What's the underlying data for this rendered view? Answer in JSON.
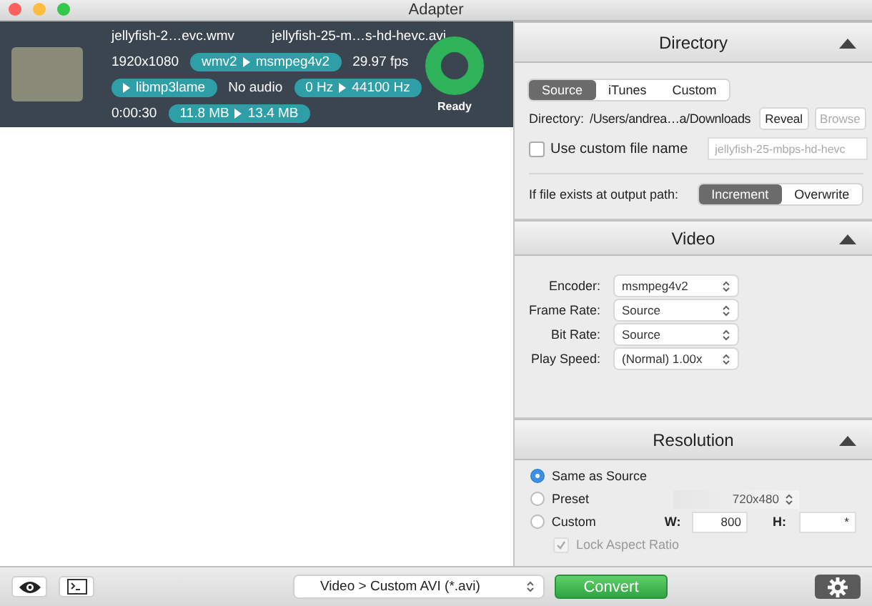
{
  "window": {
    "title": "Adapter"
  },
  "file_item": {
    "source_name": "jellyfish-2…evc.wmv",
    "output_name": "jellyfish-25-m…s-hd-hevc.avi",
    "resolution": "1920x1080",
    "video_codec": {
      "from": "wmv2",
      "to": "msmpeg4v2"
    },
    "fps": "29.97 fps",
    "audio_codec": {
      "to": "libmp3lame"
    },
    "audio_status": "No audio",
    "sample_rate": {
      "from": "0 Hz",
      "to": "44100 Hz"
    },
    "duration": "0:00:30",
    "size": {
      "from": "11.8 MB",
      "to": "13.4 MB"
    },
    "level": 1,
    "status": "Ready"
  },
  "directory": {
    "title": "Directory",
    "expanded": true,
    "tabs": [
      {
        "label": "Source",
        "selected": true
      },
      {
        "label": "iTunes",
        "selected": false
      },
      {
        "label": "Custom",
        "selected": false
      }
    ],
    "directory_label": "Directory:",
    "path": "/Users/andrea…a/Downloads",
    "buttons": [
      {
        "label": "Reveal",
        "disabled": false
      },
      {
        "label": "Browse",
        "disabled": true
      }
    ],
    "custom_name": {
      "label": "Use custom file name",
      "checked": false,
      "placeholder": "jellyfish-25-mbps-hd-hevc"
    },
    "exists_label": "If file exists at output path:",
    "exists_options": [
      {
        "label": "Increment",
        "selected": true
      },
      {
        "label": "Overwrite",
        "selected": false
      }
    ]
  },
  "video": {
    "title": "Video",
    "expanded": true,
    "fields": [
      {
        "label": "Encoder:",
        "value": "msmpeg4v2"
      },
      {
        "label": "Frame Rate:",
        "value": "Source"
      },
      {
        "label": "Bit Rate:",
        "value": "Source"
      },
      {
        "label": "Play Speed:",
        "value": "(Normal) 1.00x"
      }
    ]
  },
  "resolution": {
    "title": "Resolution",
    "expanded": true,
    "options": [
      {
        "kind": "plain",
        "label": "Same as Source",
        "selected": true
      },
      {
        "kind": "preset",
        "label": "Preset",
        "selected": false,
        "value": "720x480"
      },
      {
        "kind": "custom",
        "label": "Custom",
        "selected": false,
        "width_label": "W:",
        "width_value": "800",
        "height_label": "H:",
        "height_value": "*"
      }
    ],
    "lock": {
      "label": "Lock Aspect Ratio",
      "checked": true,
      "disabled": true
    }
  },
  "bottom_bar": {
    "format": "Video > Custom AVI (*.avi)",
    "convert": "Convert"
  }
}
